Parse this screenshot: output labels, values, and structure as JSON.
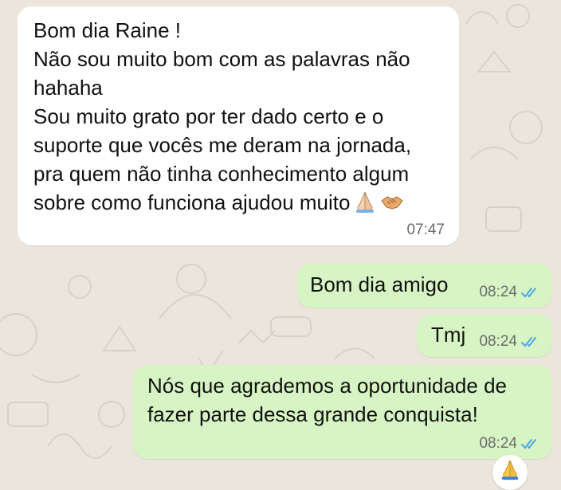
{
  "incoming_message": {
    "lines": [
      "Bom dia Raine !",
      "Não sou muito bom com as palavras não",
      "hahaha",
      "Sou muito grato por ter dado certo e o",
      "suporte que vocês me deram na jornada,",
      "pra quem não tinha conhecimento algum",
      "sobre como funciona ajudou muito"
    ],
    "emojis": [
      "praying-hands-icon",
      "handshake-icon"
    ],
    "time": "07:47"
  },
  "outgoing_messages": [
    {
      "text": "Bom dia amigo",
      "time": "08:24",
      "status": "read"
    },
    {
      "text": "Tmj",
      "time": "08:24",
      "status": "read"
    },
    {
      "lines": [
        "Nós que agrademos a oportunidade de",
        "fazer parte dessa grande conquista!"
      ],
      "time": "08:24",
      "status": "read"
    }
  ],
  "reaction": {
    "icon": "praying-hands-icon"
  },
  "colors": {
    "chat_background": "#ece5dc",
    "incoming_bubble": "#ffffff",
    "outgoing_bubble": "#d7f5c4",
    "read_ticks": "#4fa6e5",
    "timestamp": "#6b6b6b"
  }
}
